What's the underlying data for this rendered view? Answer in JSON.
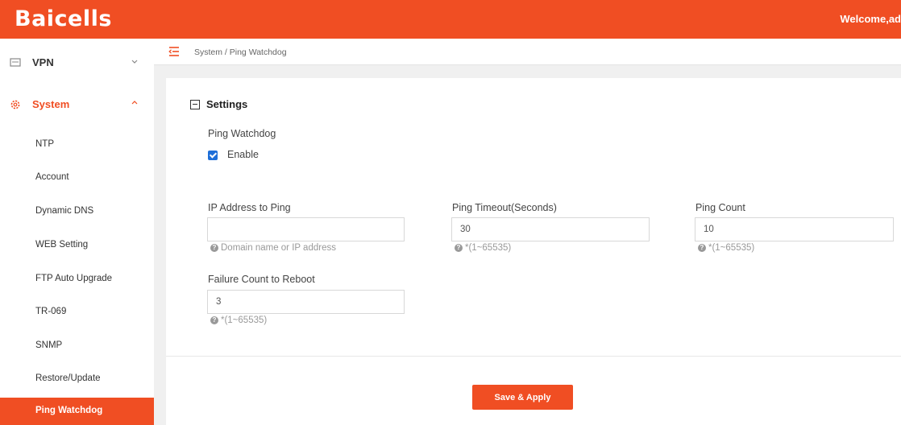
{
  "header": {
    "logo": "Baicells",
    "welcome": "Welcome,ad"
  },
  "sidebar": {
    "groups": [
      {
        "label": "VPN",
        "icon": "vpn-icon",
        "expanded": false
      },
      {
        "label": "System",
        "icon": "gear-icon",
        "expanded": true
      }
    ],
    "items": [
      {
        "label": "NTP"
      },
      {
        "label": "Account"
      },
      {
        "label": "Dynamic DNS"
      },
      {
        "label": "WEB Setting"
      },
      {
        "label": "FTP Auto Upgrade"
      },
      {
        "label": "TR-069"
      },
      {
        "label": "SNMP"
      },
      {
        "label": "Restore/Update"
      },
      {
        "label": "Ping Watchdog",
        "active": true
      }
    ]
  },
  "breadcrumb": "System / Ping Watchdog",
  "settings": {
    "title": "Settings",
    "section_label": "Ping Watchdog",
    "enable_label": "Enable",
    "enabled": true,
    "fields": {
      "ip": {
        "label": "IP Address to Ping",
        "value": "",
        "hint": "Domain name or IP address"
      },
      "timeout": {
        "label": "Ping Timeout(Seconds)",
        "value": "30",
        "hint": "*(1~65535)"
      },
      "count": {
        "label": "Ping Count",
        "value": "10",
        "hint": "*(1~65535)"
      },
      "failure": {
        "label": "Failure Count to Reboot",
        "value": "3",
        "hint": "*(1~65535)"
      }
    }
  },
  "actions": {
    "save_label": "Save & Apply"
  },
  "colors": {
    "accent": "#f04e23",
    "checkbox": "#1f6fd8"
  }
}
